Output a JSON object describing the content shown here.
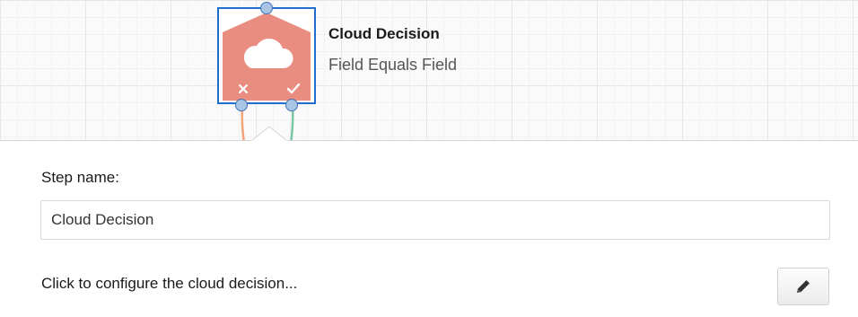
{
  "node": {
    "title": "Cloud Decision",
    "subtitle": "Field Equals Field",
    "icon": "cloud-icon",
    "no_icon": "x-icon",
    "yes_icon": "check-icon",
    "fill_color": "#e98d80",
    "selection_color": "#1f6fd0",
    "no_connector_color": "#f3a27a",
    "yes_connector_color": "#7cc7a3"
  },
  "panel": {
    "step_name_label": "Step name:",
    "step_name_value": "Cloud Decision",
    "configure_text": "Click to configure the cloud decision...",
    "edit_icon": "pencil-icon"
  }
}
